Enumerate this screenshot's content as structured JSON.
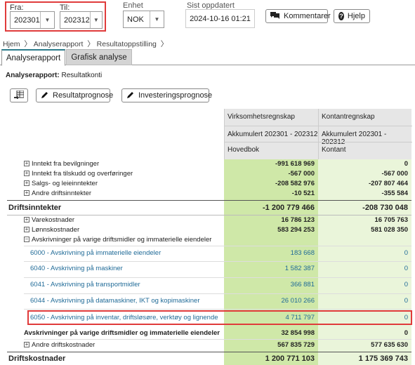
{
  "filters": {
    "from_label": "Fra:",
    "from_value": "202301",
    "to_label": "Til:",
    "to_value": "202312",
    "unit_label": "Enhet",
    "unit_value": "NOK",
    "updated_label": "Sist oppdatert",
    "updated_value": "2024-10-16 01:21",
    "comment_button": "Kommentarer",
    "help_button": "Hjelp"
  },
  "breadcrumb": [
    "Hjem",
    "Analyserapport",
    "Resultatoppstilling"
  ],
  "tabs": [
    "Analyserapport",
    "Grafisk analyse"
  ],
  "report": {
    "prefix": "Analyserapport:",
    "name": "Resultatkonti"
  },
  "toolbar": {
    "forecast_button": "Resultatprognose",
    "investment_button": "Investeringsprognose"
  },
  "columns": {
    "col1_header": "Virksomhetsregnskap",
    "col2_header": "Kontantregnskap",
    "col1_period": "Akkumulert 202301 - 202312",
    "col2_period": "Akkumulert 202301 - 202312",
    "col1_sub": "Hovedbok",
    "col2_sub": "Kontant"
  },
  "rows": [
    {
      "label": "Inntekt fra bevilgninger",
      "v1": "-991 618 969",
      "v2": "0"
    },
    {
      "label": "Inntekt fra tilskudd og overføringer",
      "v1": "-567 000",
      "v2": "-567 000"
    },
    {
      "label": "Salgs- og leieinntekter",
      "v1": "-208 582 976",
      "v2": "-207 807 464"
    },
    {
      "label": "Andre driftsinntekter",
      "v1": "-10 521",
      "v2": "-355 584"
    },
    {
      "label": "Driftsinntekter",
      "v1": "-1 200 779 466",
      "v2": "-208 730 048"
    },
    {
      "label": "Varekostnader",
      "v1": "16 786 123",
      "v2": "16 705 763"
    },
    {
      "label": "Lønnskostnader",
      "v1": "583 294 253",
      "v2": "581 028 350"
    },
    {
      "label": "Avskrivninger på varige driftsmidler og immaterielle eiendeler"
    },
    {
      "label": "6000 - Avskrivning på immaterielle eiendeler",
      "v1": "183 668",
      "v2": "0"
    },
    {
      "label": "6040 - Avskrivning på maskiner",
      "v1": "1 582 387",
      "v2": "0"
    },
    {
      "label": "6041 - Avskrivning på transportmidler",
      "v1": "366 881",
      "v2": "0"
    },
    {
      "label": "6044 - Avskrivning på datamaskiner, IKT og kopimaskiner",
      "v1": "26 010 266",
      "v2": "0"
    },
    {
      "label": "6050 - Avskrivning på inventar, driftsløsøre, verktøy og lignende",
      "v1": "4 711 797",
      "v2": "0"
    },
    {
      "label": "Avskrivninger på varige driftsmidler og immaterielle eiendeler",
      "v1": "32 854 998",
      "v2": "0"
    },
    {
      "label": "Andre driftskostnader",
      "v1": "567 835 729",
      "v2": "577 635 630"
    },
    {
      "label": "Driftskostnader",
      "v1": "1 200 771 103",
      "v2": "1 175 369 743"
    }
  ],
  "colors": {
    "highlight_red": "#e03b3b",
    "green_column": "#cfe8a8",
    "green_column_light": "#e9f4d8",
    "link_blue": "#1f6a97",
    "header_gray": "#e6e6e6",
    "tab_active": "#ffffff",
    "tab_inactive": "#d4d4d4"
  },
  "icons": [
    "chevron-down-icon",
    "comment-icon",
    "help-icon",
    "excel-export-icon",
    "pencil-icon",
    "expand-icon"
  ]
}
